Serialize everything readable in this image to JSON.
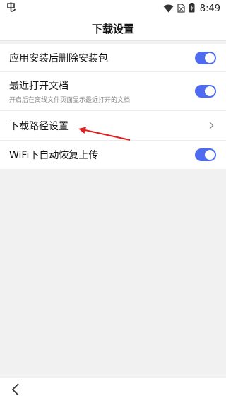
{
  "status_bar": {
    "time": "8:49",
    "app_icon": "app-logo-icon",
    "icons": [
      "wifi-icon",
      "no-sim-icon",
      "battery-icon"
    ]
  },
  "header": {
    "title": "下载设置"
  },
  "settings": {
    "items": [
      {
        "label": "应用安装后删除安装包",
        "control": "toggle",
        "enabled": true
      },
      {
        "label": "最近打开文档",
        "description": "开启后在离线文件页面显示最近打开的文档",
        "control": "toggle",
        "enabled": true
      },
      {
        "label": "下载路径设置",
        "control": "chevron-right-icon"
      },
      {
        "label": "WiFi下自动恢复上传",
        "control": "toggle",
        "enabled": true
      }
    ]
  },
  "annotation": {
    "type": "arrow",
    "color": "#e02020"
  },
  "bottom_nav": {
    "back_icon": "back-icon"
  },
  "colors": {
    "accent": "#4f6bf0",
    "background": "#f1f1f1"
  }
}
